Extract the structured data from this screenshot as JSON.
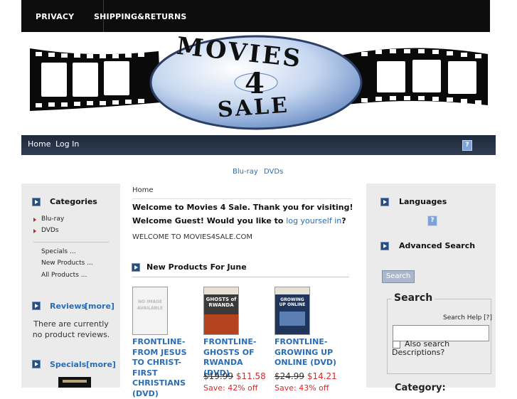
{
  "topnav": {
    "privacy": "PRIVACY",
    "shipping": "SHIPPING&RETURNS"
  },
  "logo": {
    "line1": "MOVIES",
    "line2": "4",
    "line3": "SALE"
  },
  "menu": {
    "home": "Home",
    "login": "Log In",
    "help_icon": "?"
  },
  "categories_bar": {
    "bluray": "Blu-ray",
    "dvds": "DVDs"
  },
  "left": {
    "categories_title": "Categories",
    "cat1": "Blu-ray",
    "cat2": "DVDs",
    "specials": "Specials ...",
    "new_products": "New Products ...",
    "all_products": "All Products ...",
    "reviews_title": "Reviews",
    "reviews_more": "[more]",
    "reviews_text": "There are currently no product reviews.",
    "specials_title": "Specials",
    "specials_more": "[more]"
  },
  "main": {
    "breadcrumb": "Home",
    "welcome": "Welcome to Movies 4 Sale. Thank you for visiting!",
    "guest_prefix": "Welcome Guest! Would you like to",
    "guest_link": "log yourself in",
    "guest_suffix": "?",
    "welcome_site": "WELCOME TO MOVIES4SALE.COM",
    "new_products_title": "New Products For June",
    "noimage": "NO IMAGE AVAILABLE",
    "products": [
      {
        "title": "FRONTLINE- FROM JESUS TO CHRIST-FIRST CHRISTIANS (DVD)",
        "cover": ""
      },
      {
        "title": "FRONTLINE- GHOSTS OF RWANDA (DVD)",
        "cover": "GHOSTS of RWANDA",
        "old_price": "$19.99",
        "new_price": "$11.58",
        "save": "Save: 42% off"
      },
      {
        "title": "FRONTLINE- GROWING UP ONLINE (DVD)",
        "cover": "GROWING UP ONLINE",
        "old_price": "$24.99",
        "new_price": "$14.21",
        "save": "Save: 43% off"
      }
    ]
  },
  "right": {
    "languages_title": "Languages",
    "language_icon": "?",
    "adv_search_title": "Advanced Search",
    "search_button": "Search",
    "search_legend": "Search",
    "search_help": "Search Help [?]",
    "search_placeholder": "",
    "also_search": "Also search Descriptions?",
    "category_label": "Category:"
  },
  "colors": {
    "accent": "#2a6db5",
    "sale": "#d32a2a",
    "menubar": "#243247"
  }
}
